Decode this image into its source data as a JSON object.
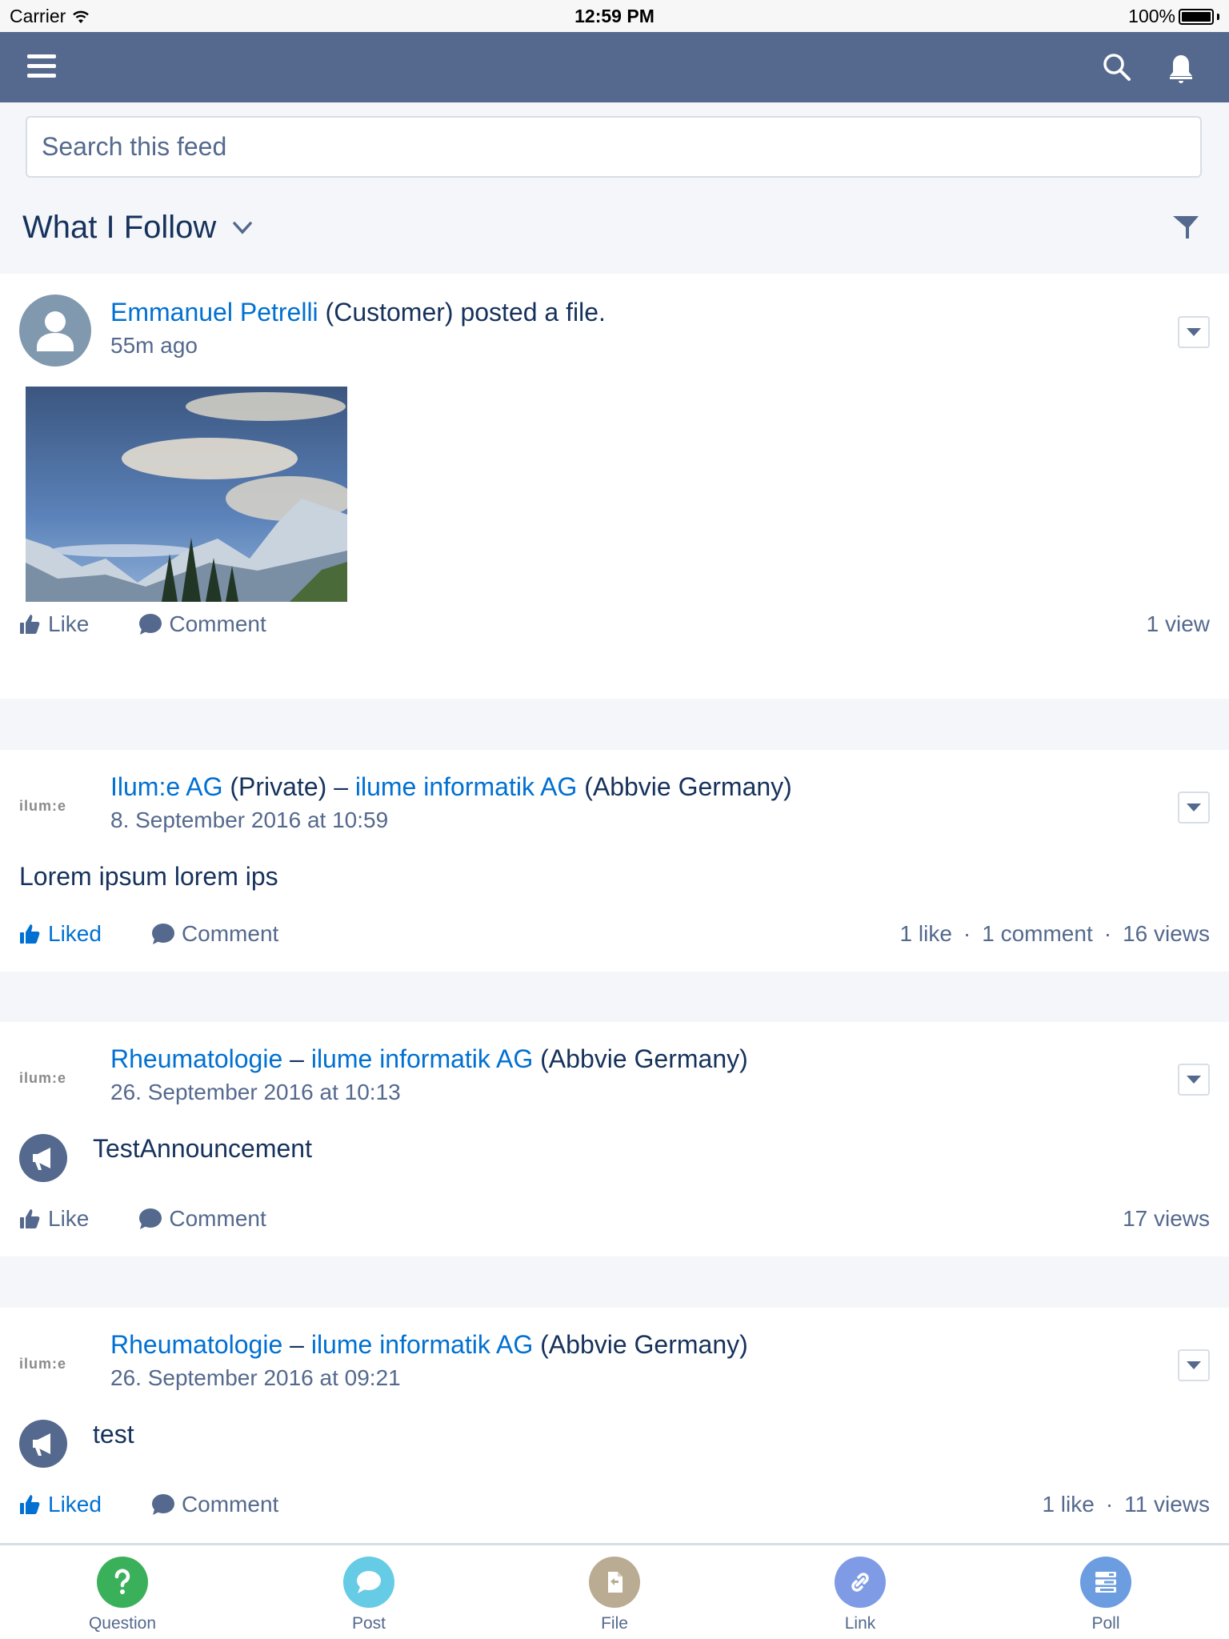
{
  "status_bar": {
    "carrier": "Carrier",
    "time": "12:59 PM",
    "battery": "100%"
  },
  "navbar": {
    "menu_icon": "hamburger-icon",
    "search_icon": "search-icon",
    "notification_icon": "bell-icon",
    "bg_color": "#54698d"
  },
  "search": {
    "placeholder": "Search this feed",
    "value": ""
  },
  "feed_header": {
    "title": "What I Follow",
    "filter_icon": "filter-icon"
  },
  "posts": [
    {
      "author": "Emmanuel Petrelli",
      "author_suffix": " (Customer) posted a file.",
      "time": "55m ago",
      "attachment": "mountain landscape image",
      "actions": {
        "like": "Like",
        "liked": false,
        "comment": "Comment"
      },
      "stats": [
        "1 view"
      ]
    },
    {
      "group": "Ilum:e AG",
      "group_suffix": " (Private) – ",
      "org": "ilume informatik AG",
      "org_suffix": " (Abbvie Germany)",
      "avatar_text": "ilum:e",
      "time": "8. September 2016 at 10:59",
      "body": "Lorem ipsum lorem ips",
      "actions": {
        "like": "Liked",
        "liked": true,
        "comment": "Comment"
      },
      "stats": [
        "1 like",
        "1 comment",
        "16 views"
      ]
    },
    {
      "group": "Rheumatologie",
      "group_suffix": " – ",
      "org": "ilume informatik AG",
      "org_suffix": " (Abbvie Germany)",
      "avatar_text": "ilum:e",
      "time": "26. September 2016 at 10:13",
      "body": "TestAnnouncement",
      "actions": {
        "like": "Like",
        "liked": false,
        "comment": "Comment"
      },
      "stats": [
        "17 views"
      ]
    },
    {
      "group": "Rheumatologie",
      "group_suffix": " – ",
      "org": "ilume informatik AG",
      "org_suffix": " (Abbvie Germany)",
      "avatar_text": "ilum:e",
      "time": "26. September 2016 at 09:21",
      "body": "test",
      "actions": {
        "like": "Liked",
        "liked": true,
        "comment": "Comment"
      },
      "stats": [
        "1 like",
        "11 views"
      ]
    }
  ],
  "publisher_tabs": [
    {
      "label": "Question",
      "icon": "question-icon",
      "color": "#3bb05b"
    },
    {
      "label": "Post",
      "icon": "post-icon",
      "color": "#66cbe4"
    },
    {
      "label": "File",
      "icon": "file-icon",
      "color": "#baac93"
    },
    {
      "label": "Link",
      "icon": "link-icon",
      "color": "#7f9be6"
    },
    {
      "label": "Poll",
      "icon": "poll-icon",
      "color": "#6b9de0"
    }
  ],
  "colors": {
    "link": "#0070d2",
    "text": "#16325c",
    "muted": "#54698d",
    "background": "#f4f6f9"
  }
}
